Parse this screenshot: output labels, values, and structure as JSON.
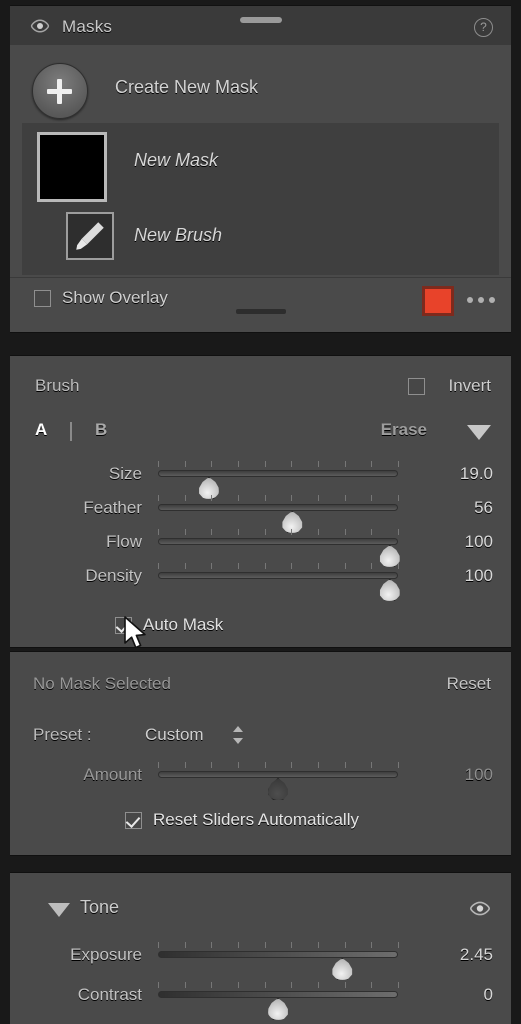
{
  "header": {
    "title": "Masks",
    "eye_icon": "eye-icon",
    "help_icon": "?",
    "grip": "panel-drag-handle"
  },
  "masks_section": {
    "create_new_mask_label": "Create New Mask",
    "plus_icon": "plus-icon",
    "mask_items": [
      {
        "name": "New Mask",
        "thumb_type": "black-thumbnail",
        "selected": true
      },
      {
        "name": "New Brush",
        "thumb_type": "brush-icon",
        "selected": false
      }
    ],
    "show_overlay_label": "Show Overlay",
    "show_overlay_checked": false,
    "overlay_color": "#e8432a",
    "more_options_icon": "ellipsis-icon"
  },
  "brush_section": {
    "title": "Brush",
    "invert_label": "Invert",
    "invert_checked": false,
    "brush_a_label": "A",
    "brush_b_label": "B",
    "erase_label": "Erase",
    "disclosure_icon": "triangle-down-icon",
    "sliders": [
      {
        "label": "Size",
        "value": "19.0",
        "pct": 21
      },
      {
        "label": "Feather",
        "value": "56",
        "pct": 56
      },
      {
        "label": "Flow",
        "value": "100",
        "pct": 97
      },
      {
        "label": "Density",
        "value": "100",
        "pct": 97
      }
    ],
    "auto_mask_label": "Auto Mask",
    "auto_mask_checked": true
  },
  "effect_section": {
    "no_mask_label": "No Mask Selected",
    "reset_label": "Reset",
    "preset_label": "Preset :",
    "preset_value": "Custom",
    "amount_label": "Amount",
    "amount_value": "100",
    "amount_pct": 50,
    "reset_sliders_label": "Reset Sliders Automatically",
    "reset_sliders_checked": true
  },
  "tone_section": {
    "title": "Tone",
    "disclosure_icon": "triangle-down-icon",
    "visibility_icon": "eye-icon",
    "sliders": [
      {
        "label": "Exposure",
        "value": "2.45",
        "pct": 77
      },
      {
        "label": "Contrast",
        "value": "0",
        "pct": 50
      }
    ]
  },
  "cursor": {
    "type": "arrow-pointer"
  }
}
